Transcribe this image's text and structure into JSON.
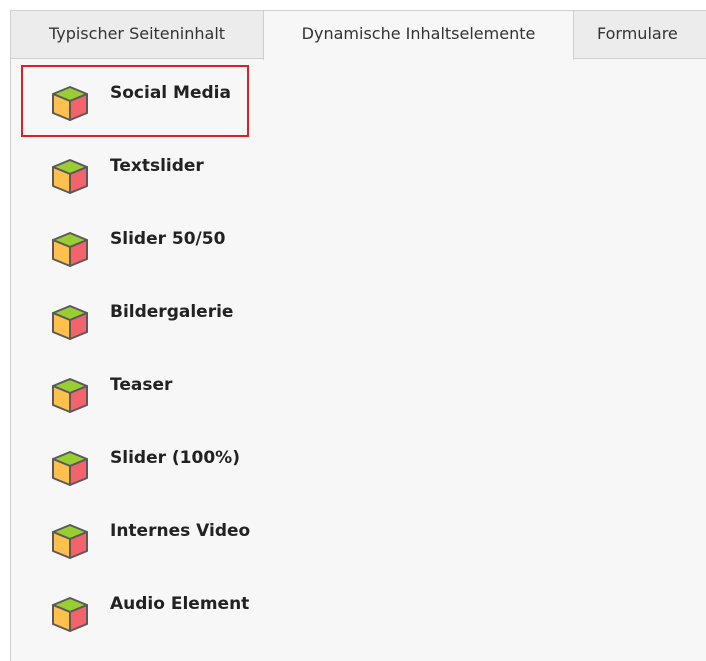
{
  "tabs": [
    {
      "label": "Typischer Seiteninhalt",
      "active": false
    },
    {
      "label": "Dynamische Inhaltselemente",
      "active": true
    },
    {
      "label": "Formulare",
      "active": false
    }
  ],
  "items": [
    {
      "label": "Social Media",
      "icon": "cube-icon",
      "highlighted": true
    },
    {
      "label": "Textslider",
      "icon": "cube-icon"
    },
    {
      "label": "Slider 50/50",
      "icon": "cube-icon"
    },
    {
      "label": "Bildergalerie",
      "icon": "cube-icon"
    },
    {
      "label": "Teaser",
      "icon": "cube-icon"
    },
    {
      "label": "Slider (100%)",
      "icon": "cube-icon"
    },
    {
      "label": "Internes Video",
      "icon": "cube-icon"
    },
    {
      "label": "Audio Element",
      "icon": "cube-icon"
    }
  ],
  "colors": {
    "cube_top": "#9acd32",
    "cube_left": "#ffc04d",
    "cube_right": "#f2636b",
    "highlight": "#e02020"
  }
}
